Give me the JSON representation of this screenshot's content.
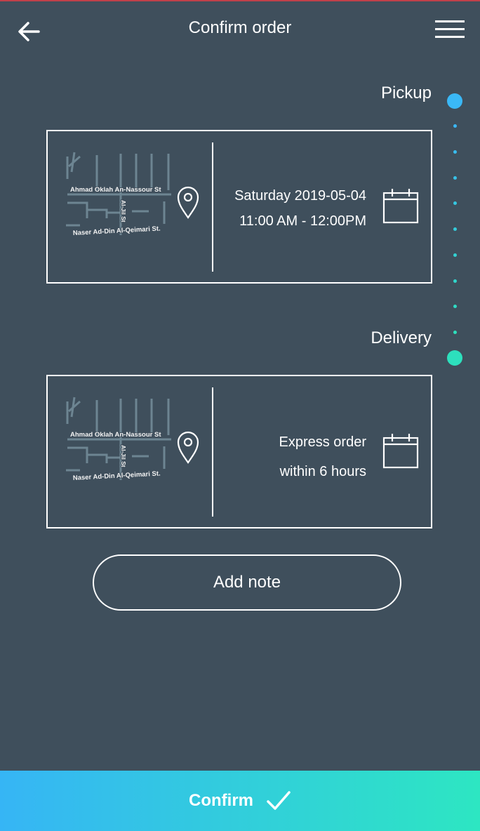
{
  "header": {
    "title": "Confirm order",
    "back_icon": "arrow-left-icon",
    "menu_icon": "hamburger-menu-icon"
  },
  "pickup": {
    "label": "Pickup",
    "map": {
      "street_top": "Ahmad Oklah An-Nassour St",
      "street_vertical": "Al-Jil St",
      "street_bottom": "Naser Ad-Din Al-Qeimari St."
    },
    "date": "Saturday 2019-05-04",
    "time": "11:00 AM - 12:00PM",
    "accent": "#3ab8f6"
  },
  "delivery": {
    "label": "Delivery",
    "map": {
      "street_top": "Ahmad Oklah An-Nassour St",
      "street_vertical": "Al-Jil St",
      "street_bottom": "Naser Ad-Din Al-Qeimari St."
    },
    "line1": "Express order",
    "line2": "within 6 hours",
    "accent": "#2de0bd"
  },
  "note_button": "Add note",
  "confirm": {
    "label": "Confirm",
    "icon": "check-icon",
    "gradient": [
      "#36b5f5",
      "#2de6c2"
    ]
  },
  "colors": {
    "background": "#3f4f5c",
    "map_road": "#6d8592"
  }
}
